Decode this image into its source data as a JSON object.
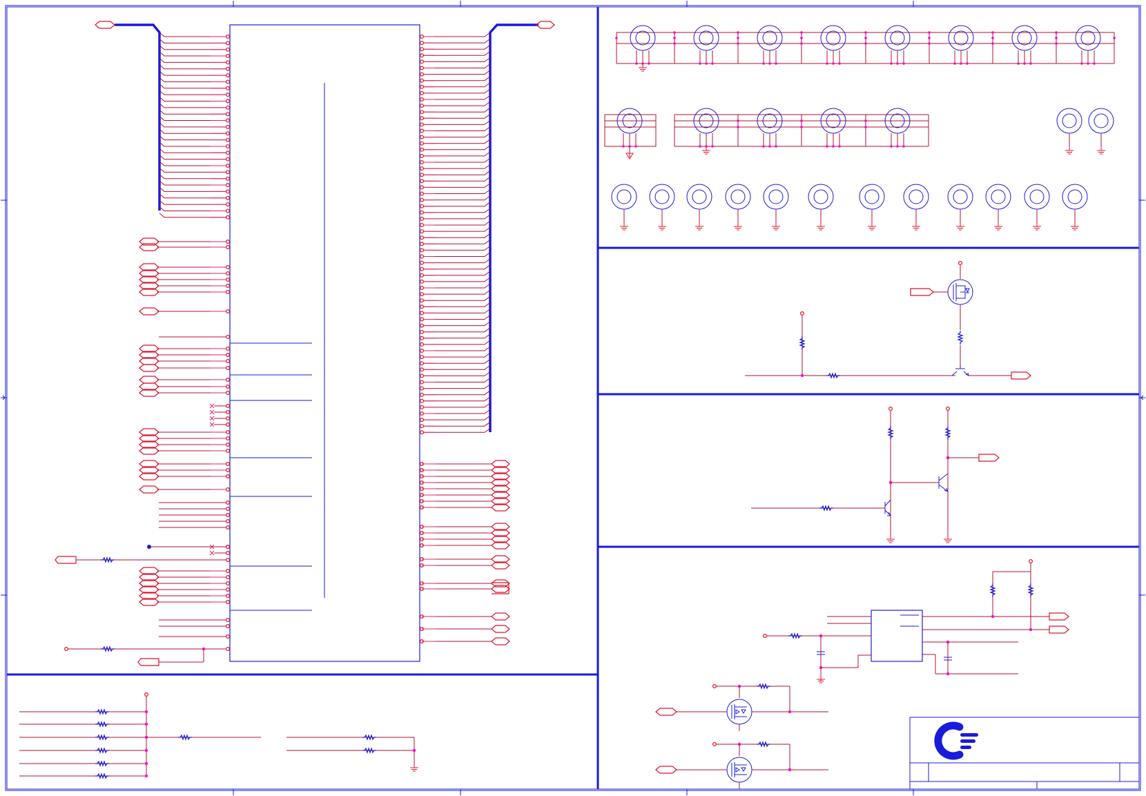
{
  "schematic": {
    "colors": {
      "wire": "#b01030",
      "pin": "#e0206a",
      "component": "#1a1adc",
      "junction": "#ff00cc",
      "background": "#ffffff"
    },
    "icons": [
      "company-logo-icon",
      "mosfet-icon",
      "npn-transistor-icon",
      "ground-icon",
      "mounting-hole-icon",
      "resistor-icon",
      "capacitor-icon"
    ],
    "title_block": {
      "logo": "company-logo-icon"
    }
  }
}
